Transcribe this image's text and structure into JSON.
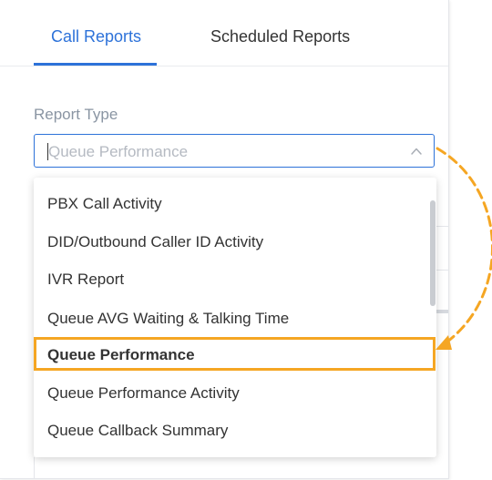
{
  "tabs": [
    {
      "label": "Call Reports",
      "active": true
    },
    {
      "label": "Scheduled Reports",
      "active": false
    }
  ],
  "report_type": {
    "label": "Report Type",
    "value": "Queue Performance",
    "chevron_icon": "chevron-up-icon"
  },
  "dropdown": {
    "options": [
      "PBX Call Activity",
      "DID/Outbound Caller ID Activity",
      "IVR Report",
      "Queue AVG Waiting & Talking Time",
      "Queue Performance",
      "Queue Performance Activity",
      "Queue Callback Summary"
    ],
    "selected_index": 4
  },
  "colors": {
    "accent": "#2d72d9",
    "highlight": "#f5a623"
  }
}
